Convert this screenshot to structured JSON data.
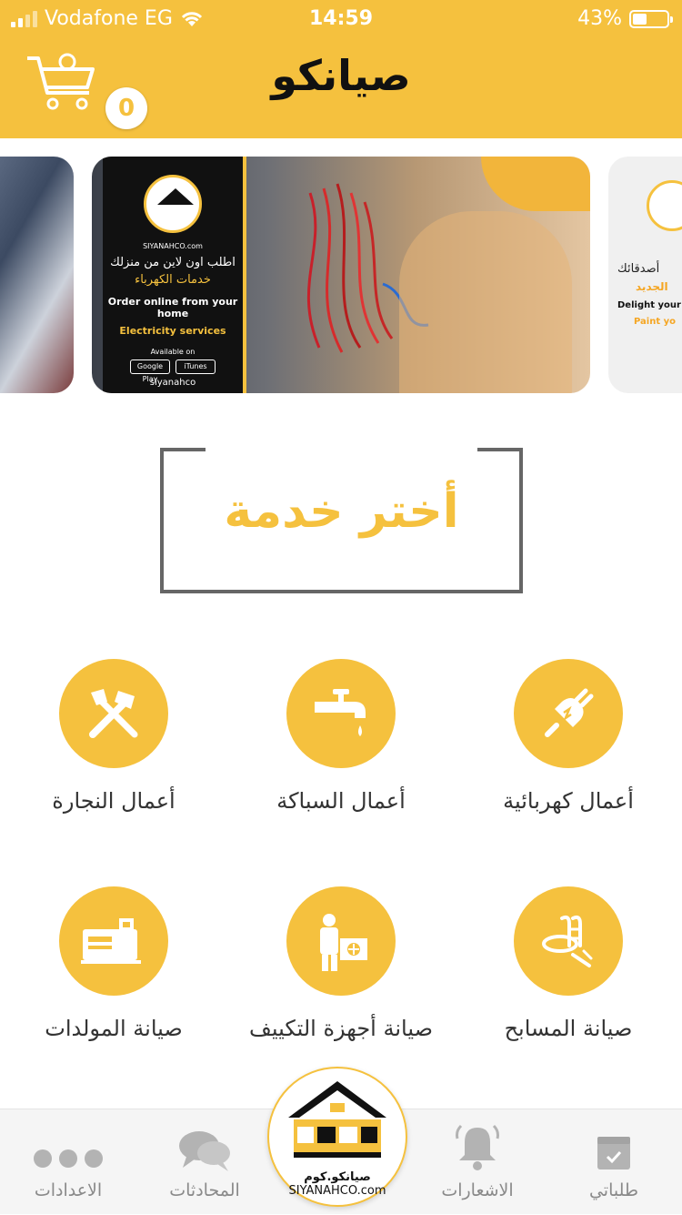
{
  "status_bar": {
    "carrier": "Vodafone EG",
    "time": "14:59",
    "battery_percent": "43%",
    "battery_level": 0.43
  },
  "header": {
    "app_title": "صيانكو",
    "cart_count": "0",
    "accent_color": "#f5c13e"
  },
  "carousel": {
    "main_slide": {
      "promo_line_ar_1": "اطلب اون لاين من منزلك",
      "promo_line_ar_2": "خدمات الكهرباء",
      "promo_line_en_1": "Order online from your home",
      "promo_line_en_2": "Electricity services",
      "available_on": "Available on",
      "google_play": "Google Play",
      "itunes": "iTunes",
      "site": "siyanahco",
      "logo_text": "SIYANAHCO.com"
    },
    "right_slide": {
      "line_ar_1": "أصدقائك",
      "line_ar_2": "الجديد",
      "line_en_1": "Delight your",
      "line_en_2": "Paint yo"
    }
  },
  "section": {
    "title": "أختر خدمة"
  },
  "services": [
    {
      "label": "أعمال النجارة",
      "icon": "tools-icon"
    },
    {
      "label": "أعمال السباكة",
      "icon": "faucet-icon"
    },
    {
      "label": "أعمال كهربائية",
      "icon": "plug-icon"
    },
    {
      "label": "صيانة المولدات",
      "icon": "generator-icon"
    },
    {
      "label": "صيانة أجهزة التكييف",
      "icon": "ac-technician-icon"
    },
    {
      "label": "صيانة المسابح",
      "icon": "pool-ladder-icon"
    }
  ],
  "bottom_nav": {
    "settings": "الاعدادات",
    "chats": "المحادثات",
    "notifications": "الاشعارات",
    "orders": "طلباتي",
    "center_brand_ar": "صيانكو.كوم",
    "center_brand_en": "SIYANAHCO.com"
  }
}
